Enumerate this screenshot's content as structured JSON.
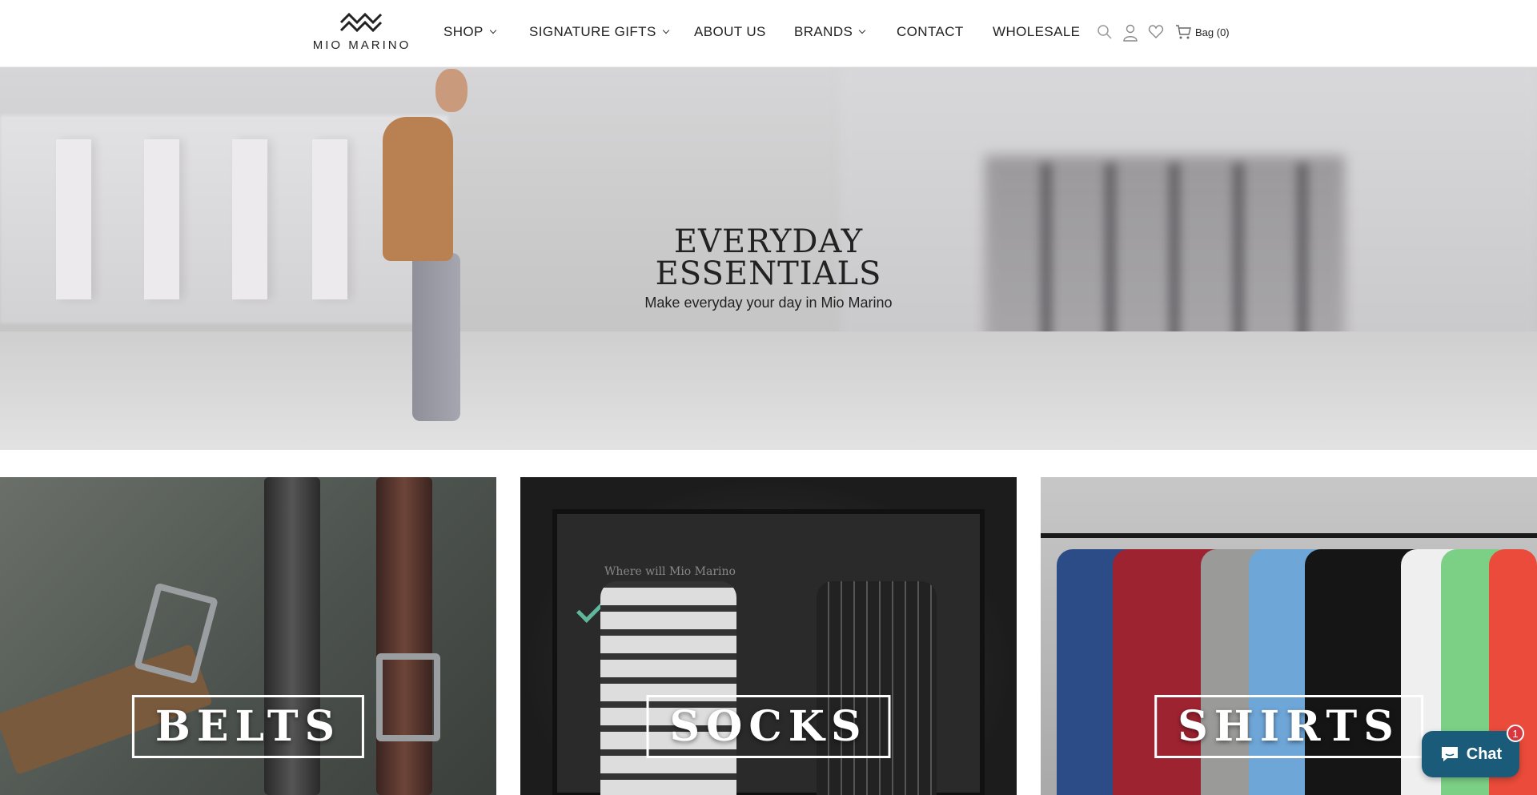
{
  "brand": {
    "name": "MIO MARINO"
  },
  "nav": {
    "items": [
      {
        "label": "SHOP",
        "has_dropdown": true
      },
      {
        "label": "SIGNATURE GIFTS",
        "has_dropdown": true
      },
      {
        "label": "ABOUT US",
        "has_dropdown": false
      },
      {
        "label": "BRANDS",
        "has_dropdown": true
      },
      {
        "label": "CONTACT",
        "has_dropdown": false
      },
      {
        "label": "WHOLESALE",
        "has_dropdown": false
      }
    ]
  },
  "header_icons": [
    "search-icon",
    "account-icon",
    "wishlist-icon",
    "cart-icon"
  ],
  "cart": {
    "label": "Bag (0)"
  },
  "hero": {
    "title_line1": "EVERYDAY",
    "title_line2": "ESSENTIALS",
    "subtitle": "Make everyday your day in Mio Marino"
  },
  "categories": [
    {
      "label": "BELTS"
    },
    {
      "label": "SOCKS"
    },
    {
      "label": "SHIRTS"
    }
  ],
  "socks_box_text": "Where will Mio Marino",
  "chat": {
    "label": "Chat",
    "badge": "1"
  },
  "colors": {
    "chat_bg": "#1b5b7a",
    "badge": "#d9363e",
    "text": "#222222"
  }
}
